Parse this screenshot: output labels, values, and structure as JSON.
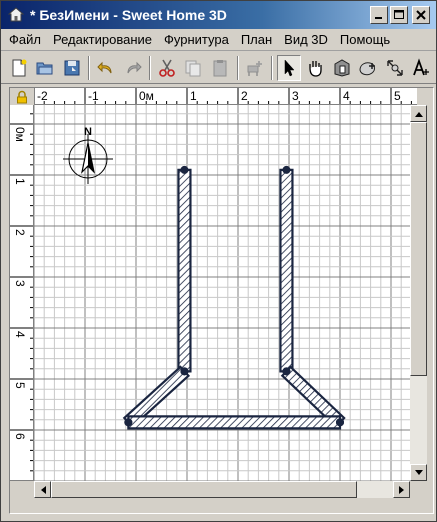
{
  "window": {
    "title": "* БезИмени - Sweet Home 3D",
    "buttons": {
      "minimize": "_",
      "maximize": "□",
      "close": "✕"
    }
  },
  "menu": {
    "items": [
      "Файл",
      "Редактирование",
      "Фурнитура",
      "План",
      "Вид 3D",
      "Помощь"
    ]
  },
  "toolbar": {
    "buttons": [
      {
        "name": "new-home",
        "icon": "new-document-icon"
      },
      {
        "name": "open",
        "icon": "folder-open-icon"
      },
      {
        "name": "save",
        "icon": "save-icon"
      },
      {
        "name": "undo",
        "icon": "undo-icon"
      },
      {
        "name": "redo",
        "icon": "redo-icon"
      },
      {
        "name": "cut",
        "icon": "scissors-icon"
      },
      {
        "name": "copy",
        "icon": "copy-icon"
      },
      {
        "name": "paste",
        "icon": "paste-icon"
      },
      {
        "name": "add-furniture",
        "icon": "add-furniture-icon"
      },
      {
        "name": "select-mode",
        "icon": "arrow-cursor-icon",
        "active": true
      },
      {
        "name": "pan-mode",
        "icon": "hand-icon"
      },
      {
        "name": "create-walls",
        "icon": "create-walls-icon"
      },
      {
        "name": "create-rooms",
        "icon": "create-rooms-icon"
      },
      {
        "name": "create-dimensions",
        "icon": "dimension-icon"
      },
      {
        "name": "add-text",
        "icon": "text-icon"
      }
    ]
  },
  "plan": {
    "ruler_h_labels": [
      "-2",
      "-1",
      "0м",
      "1",
      "2",
      "3",
      "4",
      "5"
    ],
    "ruler_v_labels": [
      "0м",
      "1",
      "2",
      "3",
      "4",
      "5",
      "6"
    ],
    "compass_label": "N",
    "colors": {
      "grid_minor": "#c8c8c8",
      "grid_major": "#808080",
      "wall_outline": "#1a2540",
      "wall_hatch": "#1a2540",
      "canvas": "#ffffff"
    },
    "walls": [
      {
        "name": "left-vertical-wall",
        "from": [
          0.95,
          0.9
        ],
        "to": [
          0.95,
          4.85
        ]
      },
      {
        "name": "right-vertical-wall",
        "from": [
          2.95,
          0.9
        ],
        "to": [
          2.95,
          4.85
        ]
      },
      {
        "name": "left-diagonal-wall",
        "from": [
          0.95,
          4.85
        ],
        "to": [
          -0.15,
          5.85
        ]
      },
      {
        "name": "right-diagonal-wall",
        "from": [
          2.95,
          4.85
        ],
        "to": [
          4.0,
          5.85
        ]
      },
      {
        "name": "bottom-wall",
        "from": [
          -0.15,
          5.85
        ],
        "to": [
          4.0,
          5.85
        ]
      }
    ]
  }
}
